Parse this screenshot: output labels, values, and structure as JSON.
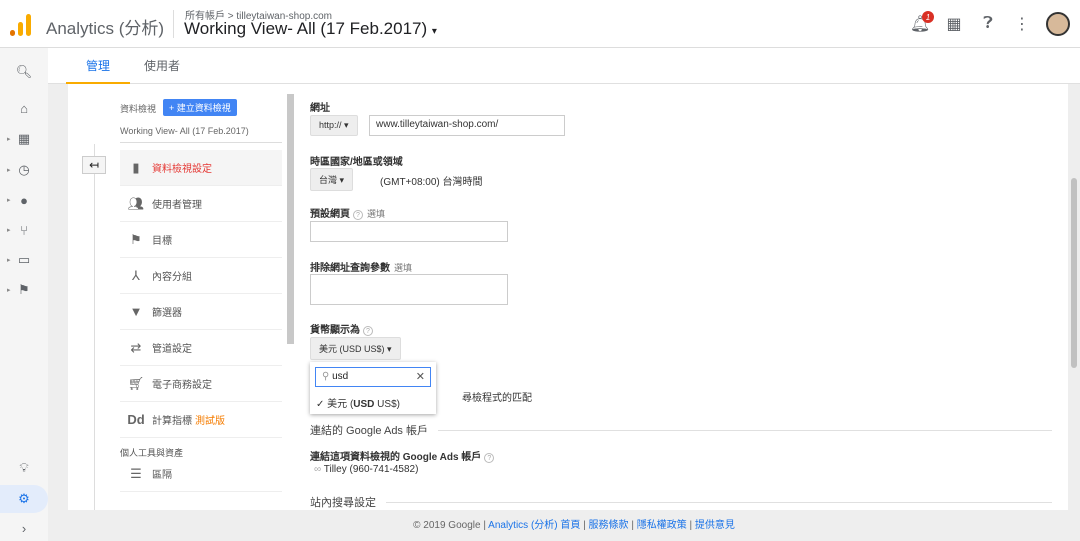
{
  "header": {
    "app_title": "Analytics (分析)",
    "breadcrumb": "所有帳戶 > tilleytaiwan-shop.com",
    "view_title": "Working View- All (17 Feb.2017)",
    "notification_count": "1"
  },
  "tabs": [
    {
      "label": "管理"
    },
    {
      "label": "使用者"
    }
  ],
  "view_column": {
    "label": "資料檢視",
    "create_button": "+ 建立資料檢視",
    "view_name": "Working View- All (17 Feb.2017)",
    "items": [
      {
        "label": "資料檢視設定",
        "icon": "document-icon"
      },
      {
        "label": "使用者管理",
        "icon": "users-icon"
      },
      {
        "label": "目標",
        "icon": "flag-icon"
      },
      {
        "label": "內容分組",
        "icon": "grouping-icon"
      },
      {
        "label": "篩選器",
        "icon": "filter-icon"
      },
      {
        "label": "管道設定",
        "icon": "channel-icon"
      },
      {
        "label": "電子商務設定",
        "icon": "cart-icon"
      },
      {
        "label": "計算指標",
        "badge": "測試版",
        "icon": "dd-icon"
      }
    ],
    "section_label": "個人工具與資產",
    "segments_label": "區隔"
  },
  "form": {
    "url_label": "網址",
    "protocol": "http://",
    "url_value": "www.tilleytaiwan-shop.com/",
    "timezone_label": "時區國家/地區或領域",
    "country": "台灣",
    "timezone": "(GMT+08:00) 台灣時間",
    "default_page_label": "預設網頁",
    "optional": "選填",
    "exclude_params_label": "排除網址查詢參數",
    "currency_label": "貨幣顯示為",
    "currency_value": "美元 (USD US$)",
    "search_value": "usd",
    "option_prefix": "美元 (",
    "option_bold": "USD",
    "option_suffix": " US$)",
    "bot_filter_tail": "尋檢程式的匹配",
    "ads_section": "連結的 Google Ads 帳戶",
    "ads_label_prefix": "連結這項資料檢視的 ",
    "ads_label_bold": "Google Ads",
    "ads_label_suffix": " 帳戶",
    "ads_account": "Tilley (960-741-4582)",
    "site_search_section": "站內搜尋設定"
  },
  "footer": {
    "copyright": "© 2019 Google | ",
    "links": [
      "Analytics (分析) 首頁",
      "服務條款",
      "隱私權政策",
      "提供意見"
    ]
  }
}
